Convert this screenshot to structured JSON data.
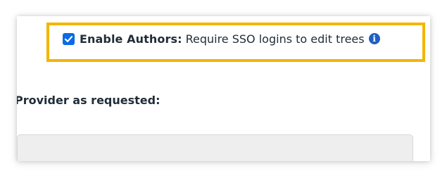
{
  "settings": {
    "enable_authors": {
      "checked": true,
      "label_bold": "Enable Authors:",
      "label_text": "Require SSO logins to edit trees",
      "info_glyph": "i"
    },
    "section_label": "Provider as requested:",
    "colors": {
      "highlight": "#f2b600",
      "checkbox": "#0b6be6",
      "info_icon": "#1f5fc1",
      "text": "#222d38"
    }
  }
}
